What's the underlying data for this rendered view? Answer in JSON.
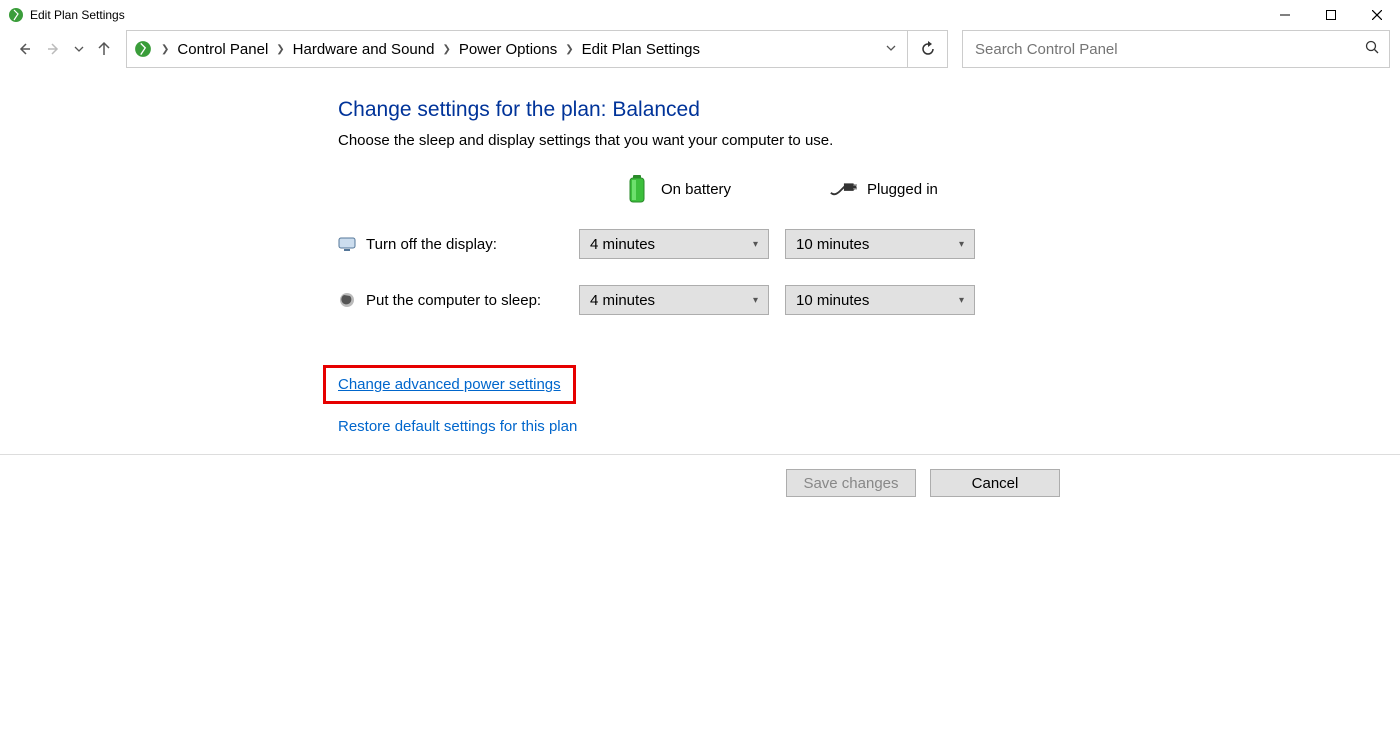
{
  "window": {
    "title": "Edit Plan Settings"
  },
  "breadcrumb": {
    "items": [
      {
        "label": "Control Panel"
      },
      {
        "label": "Hardware and Sound"
      },
      {
        "label": "Power Options"
      },
      {
        "label": "Edit Plan Settings"
      }
    ]
  },
  "search": {
    "placeholder": "Search Control Panel"
  },
  "page": {
    "heading": "Change settings for the plan: Balanced",
    "subtext": "Choose the sleep and display settings that you want your computer to use.",
    "col_battery": "On battery",
    "col_plugged": "Plugged in",
    "row_display": "Turn off the display:",
    "row_sleep": "Put the computer to sleep:",
    "display_battery_value": "4 minutes",
    "display_plugged_value": "10 minutes",
    "sleep_battery_value": "4 minutes",
    "sleep_plugged_value": "10 minutes",
    "link_advanced": "Change advanced power settings",
    "link_restore": "Restore default settings for this plan"
  },
  "buttons": {
    "save": "Save changes",
    "cancel": "Cancel"
  }
}
